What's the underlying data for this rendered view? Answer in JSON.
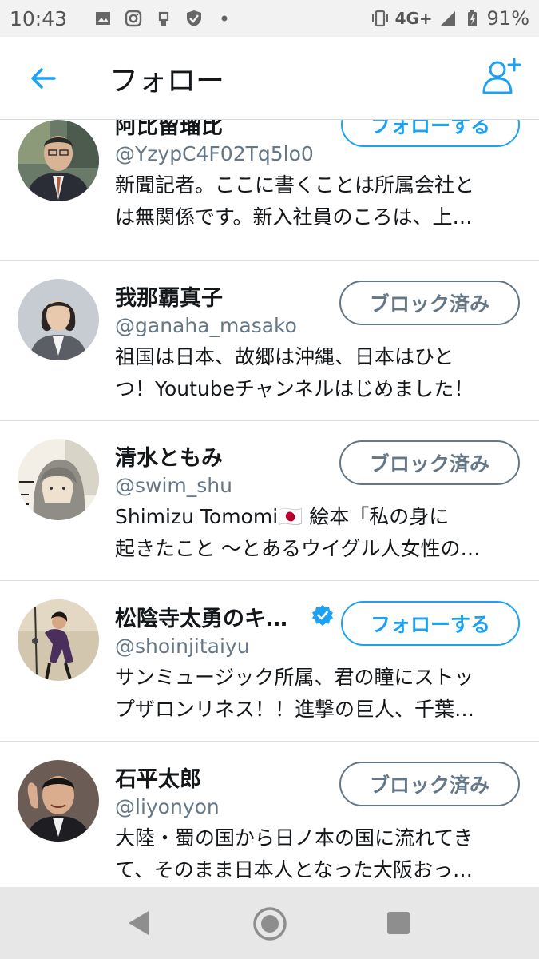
{
  "status_bar": {
    "time": "10:43",
    "network": "4G+",
    "battery": "91%",
    "icons": [
      "gallery-icon",
      "instagram-icon",
      "usb-icon",
      "shield-icon",
      "dot-icon",
      "vibrate-icon",
      "signal-icon",
      "battery-icon"
    ]
  },
  "header": {
    "title": "フォロー",
    "back_icon": "arrow-left-icon",
    "add_icon": "add-user-icon"
  },
  "colors": {
    "accent": "#1da1f2",
    "muted": "#657786",
    "divider": "#d8dee3"
  },
  "users": [
    {
      "name": "阿比留瑠比",
      "handle": "@YzypC4F02Tq5lo0",
      "bio_line1": "新聞記者。ここに書くことは所属会社と",
      "bio_line2": "は無関係です。新入社員のころは、上…",
      "button": "フォローする",
      "button_type": "follow",
      "verified": false
    },
    {
      "name": "我那覇真子",
      "handle": "@ganaha_masako",
      "bio_line1": "祖国は日本、故郷は沖縄、日本はひと",
      "bio_line2": "つ！Youtubeチャンネルはじめました！",
      "button": "ブロック済み",
      "button_type": "blocked",
      "verified": false
    },
    {
      "name": "清水ともみ",
      "handle": "@swim_shu",
      "bio_line1": "Shimizu Tomomi🇯🇵 絵本「私の身に",
      "bio_line2": "起きたこと ～とあるウイグル人女性の…",
      "button": "ブロック済み",
      "button_type": "blocked",
      "verified": false
    },
    {
      "name": "松陰寺太勇のキ…",
      "handle": "@shoinjitaiyu",
      "bio_line1": "サンミュージック所属、君の瞳にストッ",
      "bio_line2": "プザロンリネス！！進撃の巨人、千葉…",
      "button": "フォローする",
      "button_type": "follow",
      "verified": true
    },
    {
      "name": "石平太郎",
      "handle": "@liyonyon",
      "bio_line1": "大陸・蜀の国から日ノ本の国に流れてき",
      "bio_line2": "て、そのまま日本人となった大阪おっ…",
      "button": "ブロック済み",
      "button_type": "blocked",
      "verified": false
    }
  ],
  "nav": {
    "back": "nav-back-icon",
    "home": "nav-home-icon",
    "recent": "nav-recents-icon"
  }
}
